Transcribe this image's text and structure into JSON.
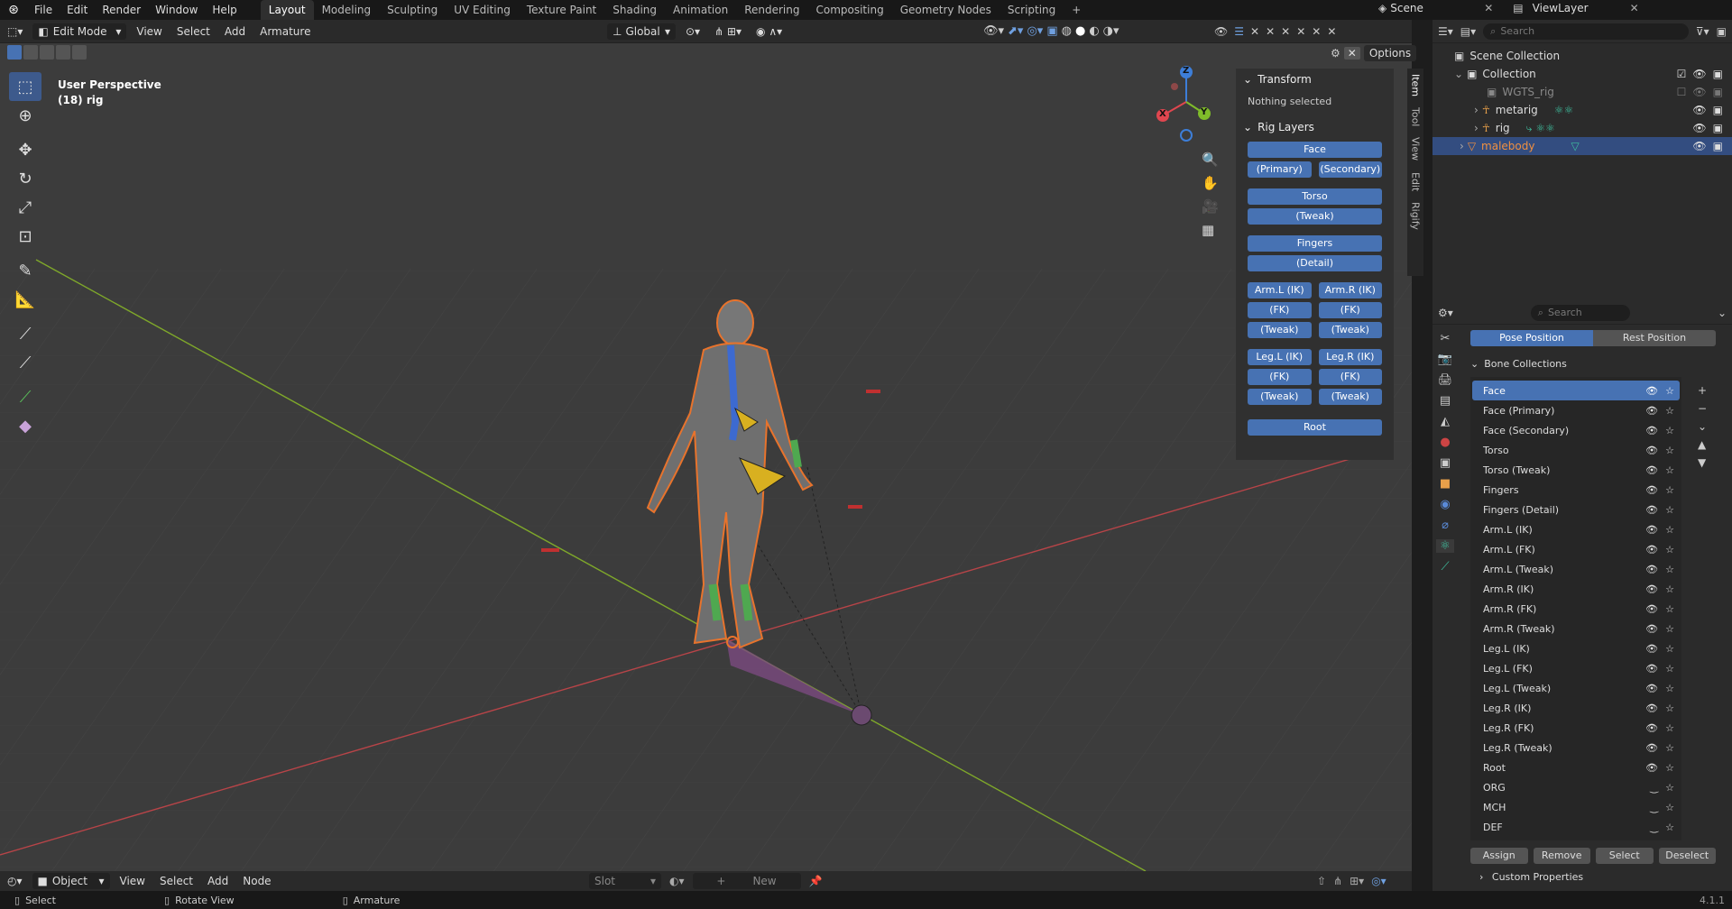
{
  "topbar": {
    "menu": [
      "File",
      "Edit",
      "Render",
      "Window",
      "Help"
    ],
    "workspaces": [
      "Layout",
      "Modeling",
      "Sculpting",
      "UV Editing",
      "Texture Paint",
      "Shading",
      "Animation",
      "Rendering",
      "Compositing",
      "Geometry Nodes",
      "Scripting"
    ],
    "add_tab": "+",
    "scene": "Scene",
    "view_layer": "ViewLayer"
  },
  "viewport_header": {
    "mode": "Edit Mode",
    "menus": [
      "View",
      "Select",
      "Add",
      "Armature"
    ],
    "orientation": "Global",
    "options": "Options"
  },
  "overlay": {
    "view_name": "User Perspective",
    "object_info": "(18) rig"
  },
  "gizmo": {
    "z": "Z",
    "x": "X",
    "y": "Y"
  },
  "npanel": {
    "transform_title": "Transform",
    "nothing_selected": "Nothing selected",
    "rig_layers_title": "Rig Layers",
    "buttons": {
      "face": "Face",
      "primary": "(Primary)",
      "secondary": "(Secondary)",
      "torso": "Torso",
      "tweak": "(Tweak)",
      "fingers": "Fingers",
      "detail": "(Detail)",
      "arm_l_ik": "Arm.L (IK)",
      "arm_r_ik": "Arm.R (IK)",
      "fk": "(FK)",
      "leg_l_ik": "Leg.L (IK)",
      "leg_r_ik": "Leg.R (IK)",
      "root": "Root"
    },
    "tabs": [
      "Item",
      "Tool",
      "View",
      "Edit",
      "Rigify"
    ]
  },
  "outliner": {
    "search_placeholder": "Search",
    "items": [
      {
        "label": "Scene Collection",
        "indent": 0
      },
      {
        "label": "Collection",
        "indent": 1
      },
      {
        "label": "WGTS_rig",
        "indent": 2
      },
      {
        "label": "metarig",
        "indent": 2
      },
      {
        "label": "rig",
        "indent": 2
      },
      {
        "label": "malebody",
        "indent": 1
      }
    ]
  },
  "properties": {
    "search_placeholder": "Search",
    "pose_position": "Pose Position",
    "rest_position": "Rest Position",
    "bone_collections_title": "Bone Collections",
    "bone_collections": [
      "Face",
      "Face (Primary)",
      "Face (Secondary)",
      "Torso",
      "Torso (Tweak)",
      "Fingers",
      "Fingers (Detail)",
      "Arm.L (IK)",
      "Arm.L (FK)",
      "Arm.L (Tweak)",
      "Arm.R (IK)",
      "Arm.R (FK)",
      "Arm.R (Tweak)",
      "Leg.L (IK)",
      "Leg.L (FK)",
      "Leg.L (Tweak)",
      "Leg.R (IK)",
      "Leg.R (FK)",
      "Leg.R (Tweak)",
      "Root",
      "ORG",
      "MCH",
      "DEF"
    ],
    "assign": "Assign",
    "remove": "Remove",
    "select": "Select",
    "deselect": "Deselect",
    "custom_properties": "Custom Properties"
  },
  "bottom_header": {
    "mode": "Object",
    "menus": [
      "View",
      "Select",
      "Add",
      "Node"
    ],
    "slot": "Slot",
    "new": "New"
  },
  "statusbar": {
    "select": "Select",
    "rotate_view": "Rotate View",
    "armature": "Armature",
    "version": "4.1.1"
  },
  "colors": {
    "accent": "#4772b3",
    "selected_orange": "#e8732c",
    "x_axis": "#e0464f",
    "y_axis": "#7fbc2a",
    "z_axis": "#3d7ed8"
  }
}
